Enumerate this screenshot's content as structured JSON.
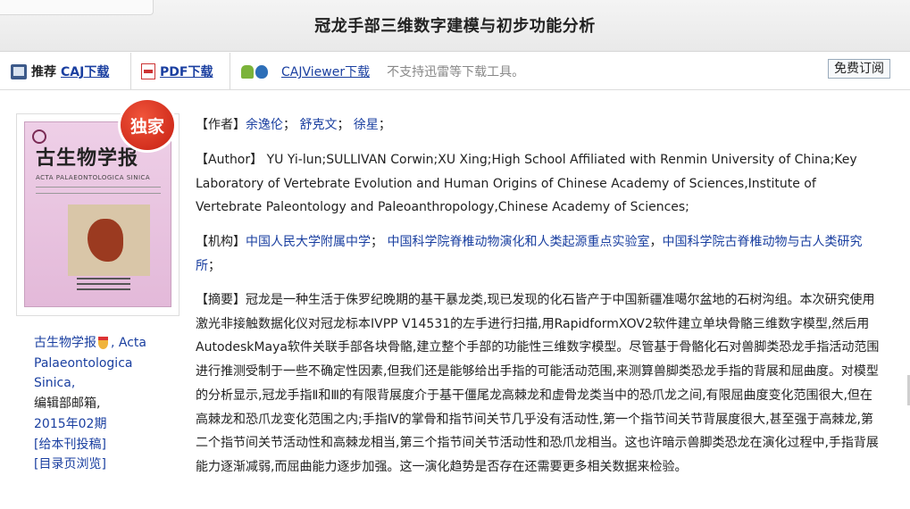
{
  "header": {
    "title": "冠龙手部三维数字建模与初步功能分析"
  },
  "toolbar": {
    "recommend_label": "推荐",
    "caj_download": "CAJ下载",
    "pdf_download": "PDF下载",
    "cajviewer_download": "CAJViewer下载",
    "note": "不支持迅雷等下载工具。",
    "free_read": "免费订阅"
  },
  "cover": {
    "journal_title": "古生物学报",
    "journal_en": "ACTA PALAEONTOLOGICA SINICA",
    "badge": "独家"
  },
  "journal": {
    "name": "古生物学报",
    "name_en_1": ", Acta",
    "name_en_2": "Palaeontologica",
    "name_en_3": "Sinica,",
    "office": "编辑部邮箱,",
    "issue": "2015年02期",
    "submit": "[给本刊投稿]",
    "toc": "[目录页浏览]"
  },
  "authors": {
    "label": "【作者】",
    "names": [
      "余逸伦",
      "舒克文",
      "徐星"
    ]
  },
  "author_en": {
    "label": "【Author】",
    "text": "YU Yi-lun;SULLIVAN Corwin;XU Xing;High School Affiliated with Renmin University of China;Key Laboratory of Vertebrate Evolution and Human Origins of Chinese Academy of Sciences,Institute of Vertebrate Paleontology and Paleoanthropology,Chinese Academy of Sciences;"
  },
  "institutions": {
    "label": "【机构】",
    "items": [
      "中国人民大学附属中学",
      "中国科学院脊椎动物演化和人类起源重点实验室",
      "中国科学院古脊椎动物与古人类研究所"
    ]
  },
  "abstract": {
    "label": "【摘要】",
    "text": "冠龙是一种生活于侏罗纪晚期的基干暴龙类,现已发现的化石皆产于中国新疆准噶尔盆地的石树沟组。本次研究使用激光非接触数据化仪对冠龙标本IVPP V14531的左手进行扫描,用RapidformXOV2软件建立单块骨骼三维数字模型,然后用AutodeskMaya软件关联手部各块骨骼,建立整个手部的功能性三维数字模型。尽管基于骨骼化石对兽脚类恐龙手指活动范围进行推测受制于一些不确定性因素,但我们还是能够给出手指的可能活动范围,来测算兽脚类恐龙手指的背展和屈曲度。对模型的分析显示,冠龙手指Ⅱ和Ⅲ的有限背展度介于基干僵尾龙高棘龙和虚骨龙类当中的恐爪龙之间,有限屈曲度变化范围很大,但在高棘龙和恐爪龙变化范围之内;手指Ⅳ的掌骨和指节间关节几乎没有活动性,第一个指节间关节背展度很大,甚至强于高棘龙,第二个指节间关节活动性和高棘龙相当,第三个指节间关节活动性和恐爪龙相当。这也许暗示兽脚类恐龙在演化过程中,手指背展能力逐渐减弱,而屈曲能力逐步加强。这一演化趋势是否存在还需要更多相关数据来检验。"
  }
}
